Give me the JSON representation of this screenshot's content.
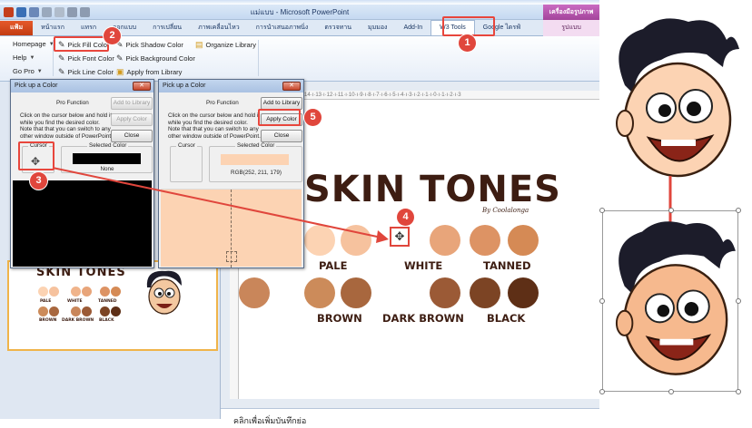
{
  "window": {
    "title": "แม่แบบ - Microsoft PowerPoint",
    "context_tab_group": "เครื่องมือรูปภาพ"
  },
  "tabs": [
    {
      "label": "แฟ้ม"
    },
    {
      "label": "หน้าแรก"
    },
    {
      "label": "แทรก"
    },
    {
      "label": "ออกแบบ"
    },
    {
      "label": "การเปลี่ยน"
    },
    {
      "label": "ภาพเคลื่อนไหว"
    },
    {
      "label": "การนำเสนอภาพนิ่ง"
    },
    {
      "label": "ตรวจทาน"
    },
    {
      "label": "มุมมอง"
    },
    {
      "label": "Add-In"
    },
    {
      "label": "W3 Tools"
    },
    {
      "label": "Google ไดรฟ์"
    },
    {
      "label": "รูปแบบ"
    }
  ],
  "ribbon": {
    "menus": [
      "Homepage",
      "Help",
      "Go Pro"
    ],
    "col1": [
      "Pick Fill Color",
      "Pick Font Color",
      "Pick Line Color"
    ],
    "col2": [
      "Pick Shadow Color",
      "Pick Background Color",
      "Apply from Library"
    ],
    "col3": [
      "Organize Library"
    ]
  },
  "dialog1": {
    "title": "Pick up a Color",
    "pro_function": "Pro Function",
    "add_to_library": "Add to Library",
    "apply_color": "Apply Color",
    "close": "Close",
    "instructions": "Click on the cursor below and hold it while you find the desired color. Note that that you can switch to any other window outside of PowerPoint.",
    "cursor_label": "Cursor",
    "selected_label": "Selected Color",
    "selected_value": "None",
    "swatch_color": "#000000"
  },
  "dialog2": {
    "title": "Pick up a Color",
    "pro_function": "Pro Function",
    "add_to_library": "Add to Library",
    "apply_color": "Apply Color",
    "close": "Close",
    "instructions": "Click on the cursor below and hold it while you find the desired color. Note that that you can switch to any other window outside of PowerPoint.",
    "cursor_label": "Cursor",
    "selected_label": "Selected Color",
    "selected_value": "RGB(252, 211, 179)",
    "swatch_color": "#fcd3b3"
  },
  "slide": {
    "title": "SKIN TONES",
    "byline": "By Coolalonga",
    "row1_labels": [
      "PALE",
      "WHITE",
      "TANNED"
    ],
    "row2_labels": [
      "BROWN",
      "DARK BROWN",
      "BLACK"
    ],
    "swatches_row1": [
      "#fcd3b3",
      "#f6c29e",
      "#f0b48b",
      "#e8a57a",
      "#dd9364",
      "#d58a55"
    ],
    "swatches_row2": [
      "#cc8b5a",
      "#a8673e",
      "#c9865a",
      "#9b5a36",
      "#7c4424",
      "#5e2f16"
    ]
  },
  "thumbnail": {
    "title": "SKIN TONES",
    "row1_labels": [
      "PALE",
      "WHITE",
      "TANNED"
    ],
    "row2_labels": [
      "BROWN",
      "DARK BROWN",
      "BLACK"
    ]
  },
  "notes": {
    "placeholder": "คลิกเพื่อเพิ่มบันทึกย่อ"
  },
  "callouts": [
    "1",
    "2",
    "3",
    "4",
    "5"
  ],
  "colors": {
    "accent_red": "#e0463c",
    "ribbon_blue": "#dfe9f5"
  }
}
